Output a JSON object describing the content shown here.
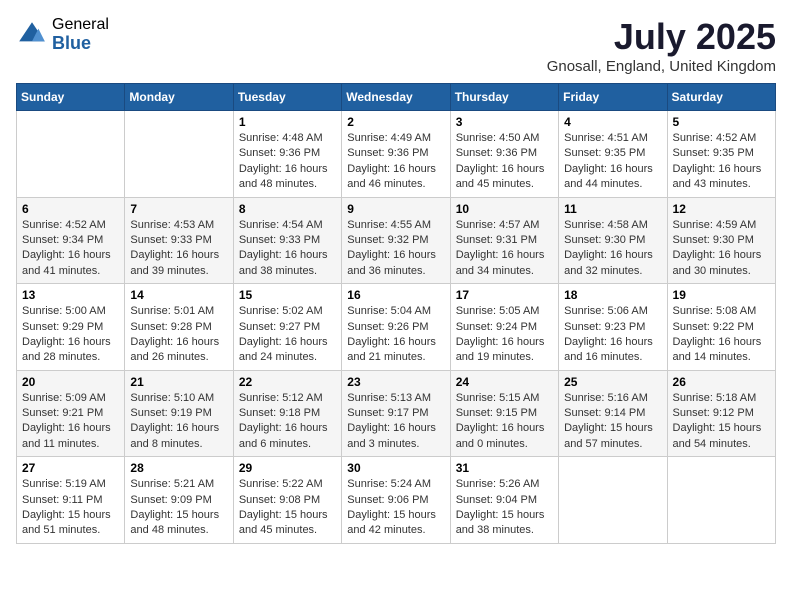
{
  "logo": {
    "general": "General",
    "blue": "Blue"
  },
  "title": "July 2025",
  "location": "Gnosall, England, United Kingdom",
  "days_header": [
    "Sunday",
    "Monday",
    "Tuesday",
    "Wednesday",
    "Thursday",
    "Friday",
    "Saturday"
  ],
  "weeks": [
    [
      null,
      null,
      {
        "num": "1",
        "sunrise": "4:48 AM",
        "sunset": "9:36 PM",
        "daylight": "16 hours and 48 minutes."
      },
      {
        "num": "2",
        "sunrise": "4:49 AM",
        "sunset": "9:36 PM",
        "daylight": "16 hours and 46 minutes."
      },
      {
        "num": "3",
        "sunrise": "4:50 AM",
        "sunset": "9:36 PM",
        "daylight": "16 hours and 45 minutes."
      },
      {
        "num": "4",
        "sunrise": "4:51 AM",
        "sunset": "9:35 PM",
        "daylight": "16 hours and 44 minutes."
      },
      {
        "num": "5",
        "sunrise": "4:52 AM",
        "sunset": "9:35 PM",
        "daylight": "16 hours and 43 minutes."
      }
    ],
    [
      {
        "num": "6",
        "sunrise": "4:52 AM",
        "sunset": "9:34 PM",
        "daylight": "16 hours and 41 minutes."
      },
      {
        "num": "7",
        "sunrise": "4:53 AM",
        "sunset": "9:33 PM",
        "daylight": "16 hours and 39 minutes."
      },
      {
        "num": "8",
        "sunrise": "4:54 AM",
        "sunset": "9:33 PM",
        "daylight": "16 hours and 38 minutes."
      },
      {
        "num": "9",
        "sunrise": "4:55 AM",
        "sunset": "9:32 PM",
        "daylight": "16 hours and 36 minutes."
      },
      {
        "num": "10",
        "sunrise": "4:57 AM",
        "sunset": "9:31 PM",
        "daylight": "16 hours and 34 minutes."
      },
      {
        "num": "11",
        "sunrise": "4:58 AM",
        "sunset": "9:30 PM",
        "daylight": "16 hours and 32 minutes."
      },
      {
        "num": "12",
        "sunrise": "4:59 AM",
        "sunset": "9:30 PM",
        "daylight": "16 hours and 30 minutes."
      }
    ],
    [
      {
        "num": "13",
        "sunrise": "5:00 AM",
        "sunset": "9:29 PM",
        "daylight": "16 hours and 28 minutes."
      },
      {
        "num": "14",
        "sunrise": "5:01 AM",
        "sunset": "9:28 PM",
        "daylight": "16 hours and 26 minutes."
      },
      {
        "num": "15",
        "sunrise": "5:02 AM",
        "sunset": "9:27 PM",
        "daylight": "16 hours and 24 minutes."
      },
      {
        "num": "16",
        "sunrise": "5:04 AM",
        "sunset": "9:26 PM",
        "daylight": "16 hours and 21 minutes."
      },
      {
        "num": "17",
        "sunrise": "5:05 AM",
        "sunset": "9:24 PM",
        "daylight": "16 hours and 19 minutes."
      },
      {
        "num": "18",
        "sunrise": "5:06 AM",
        "sunset": "9:23 PM",
        "daylight": "16 hours and 16 minutes."
      },
      {
        "num": "19",
        "sunrise": "5:08 AM",
        "sunset": "9:22 PM",
        "daylight": "16 hours and 14 minutes."
      }
    ],
    [
      {
        "num": "20",
        "sunrise": "5:09 AM",
        "sunset": "9:21 PM",
        "daylight": "16 hours and 11 minutes."
      },
      {
        "num": "21",
        "sunrise": "5:10 AM",
        "sunset": "9:19 PM",
        "daylight": "16 hours and 8 minutes."
      },
      {
        "num": "22",
        "sunrise": "5:12 AM",
        "sunset": "9:18 PM",
        "daylight": "16 hours and 6 minutes."
      },
      {
        "num": "23",
        "sunrise": "5:13 AM",
        "sunset": "9:17 PM",
        "daylight": "16 hours and 3 minutes."
      },
      {
        "num": "24",
        "sunrise": "5:15 AM",
        "sunset": "9:15 PM",
        "daylight": "16 hours and 0 minutes."
      },
      {
        "num": "25",
        "sunrise": "5:16 AM",
        "sunset": "9:14 PM",
        "daylight": "15 hours and 57 minutes."
      },
      {
        "num": "26",
        "sunrise": "5:18 AM",
        "sunset": "9:12 PM",
        "daylight": "15 hours and 54 minutes."
      }
    ],
    [
      {
        "num": "27",
        "sunrise": "5:19 AM",
        "sunset": "9:11 PM",
        "daylight": "15 hours and 51 minutes."
      },
      {
        "num": "28",
        "sunrise": "5:21 AM",
        "sunset": "9:09 PM",
        "daylight": "15 hours and 48 minutes."
      },
      {
        "num": "29",
        "sunrise": "5:22 AM",
        "sunset": "9:08 PM",
        "daylight": "15 hours and 45 minutes."
      },
      {
        "num": "30",
        "sunrise": "5:24 AM",
        "sunset": "9:06 PM",
        "daylight": "15 hours and 42 minutes."
      },
      {
        "num": "31",
        "sunrise": "5:26 AM",
        "sunset": "9:04 PM",
        "daylight": "15 hours and 38 minutes."
      },
      null,
      null
    ]
  ]
}
